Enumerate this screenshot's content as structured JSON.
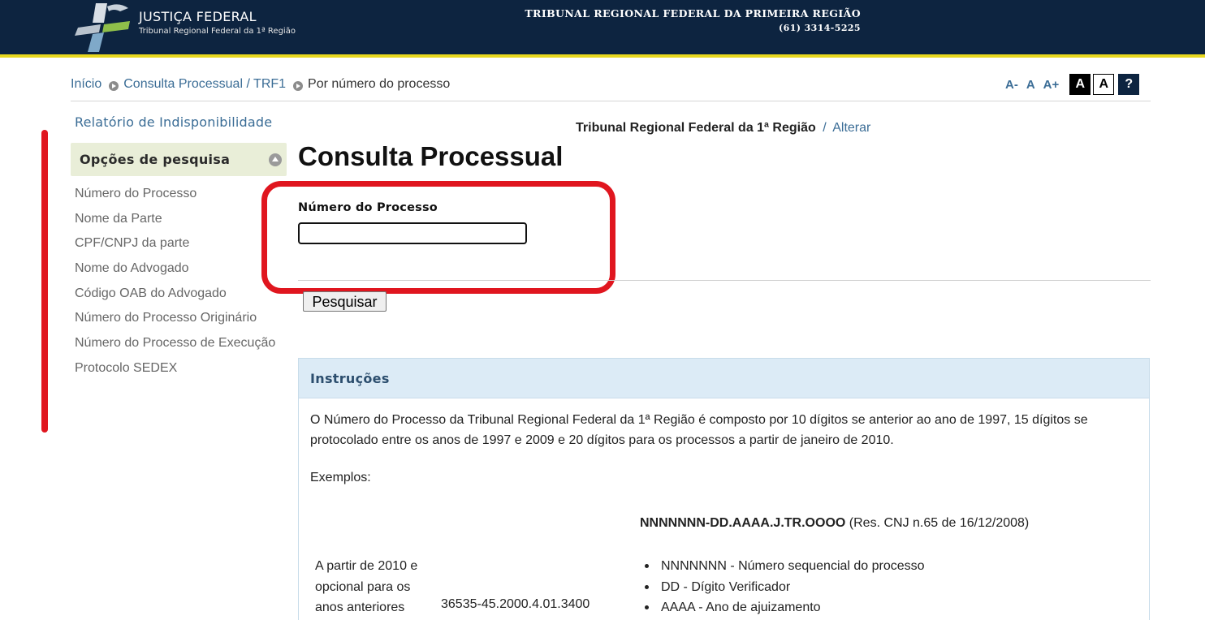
{
  "header": {
    "logo_title": "JUSTIÇA FEDERAL",
    "logo_subtitle": "Tribunal Regional Federal da 1ª Região",
    "tribunal_name": "TRIBUNAL REGIONAL FEDERAL DA PRIMEIRA REGIÃO",
    "phone": "(61) 3314-5225"
  },
  "breadcrumb": {
    "home": "Início",
    "section": "Consulta Processual / TRF1",
    "current": "Por número do processo"
  },
  "font_controls": {
    "decrease": "A-",
    "normal": "A",
    "increase": "A+",
    "contrast_dark": "A",
    "contrast_light": "A",
    "help": "?"
  },
  "sidebar": {
    "report_link": "Relatório de Indisponibilidade",
    "heading": "Opções de pesquisa",
    "items": [
      "Número do Processo",
      "Nome da Parte",
      "CPF/CNPJ da parte",
      "Nome do Advogado",
      "Código OAB do Advogado",
      "Número do Processo Originário",
      "Número do Processo de Execução",
      "Protocolo SEDEX"
    ]
  },
  "main": {
    "region_name": "Tribunal Regional Federal da 1ª Região",
    "region_separator": "/",
    "region_change": "Alterar",
    "title": "Consulta Processual",
    "field_label": "Número do Processo",
    "field_value": "",
    "search_button": "Pesquisar"
  },
  "instructions": {
    "title": "Instruções",
    "text": "O Número do Processo da Tribunal Regional Federal da 1ª Região é composto por 10 dígitos se anterior ao ano de 1997, 15 dígitos se protocolado entre os anos de 1997 e 2009 e 20 dígitos para os processos a partir de janeiro de 2010.",
    "examples_label": "Exemplos:",
    "format_code": "NNNNNNN-DD.AAAA.J.TR.OOOO",
    "format_note": "(Res. CNJ n.65 de 16/12/2008)",
    "example_description": "A partir de 2010 e opcional para os anos anteriores",
    "example_number": "36535-45.2000.4.01.3400",
    "format_parts": [
      "NNNNNNN - Número sequencial do processo",
      "DD - Dígito Verificador",
      "AAAA - Ano de ajuizamento"
    ]
  },
  "colors": {
    "header_bg": "#0d2440",
    "header_stripe": "#e8d81e",
    "link": "#3b6d96",
    "highlight": "#e0161f",
    "sidebar_head_bg": "#e9eed8",
    "instructions_head_bg": "#dcebf6"
  }
}
